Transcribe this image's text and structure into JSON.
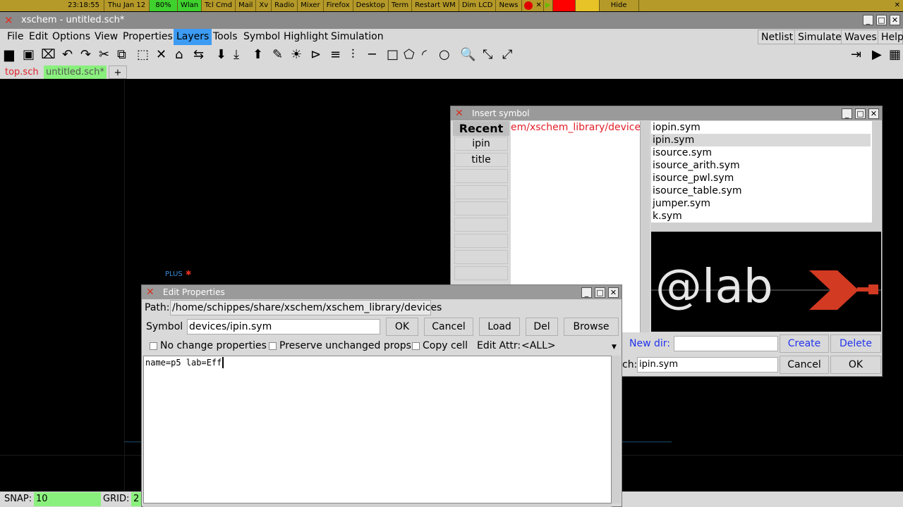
{
  "topbar": {
    "clock": "23:18:55",
    "date": "Thu Jan 12",
    "battery": "80%",
    "items": [
      "Wlan",
      "Tcl Cmd",
      "Mail",
      "Xv",
      "Radio",
      "Mixer",
      "Firefox",
      "Desktop",
      "Term",
      "Restart WM",
      "Dim LCD",
      "News"
    ],
    "hide": "Hide"
  },
  "window": {
    "title": "xschem - untitled.sch*"
  },
  "menu": {
    "items": [
      "File",
      "Edit",
      "Options",
      "View",
      "Properties",
      "Layers",
      "Tools",
      "Symbol",
      "Highlight",
      "Simulation"
    ],
    "active": "Layers",
    "right": [
      "Netlist",
      "Simulate",
      "Waves",
      "Help"
    ]
  },
  "tabs": {
    "items": [
      "top.sch",
      "untitled.sch*"
    ],
    "add": "+"
  },
  "canvas": {
    "pin_label": "PLUS"
  },
  "status": {
    "snap_label": "SNAP:",
    "snap_value": "10",
    "grid_label": "GRID:",
    "grid_value": "2"
  },
  "insert_symbol": {
    "title": "Insert symbol",
    "recent_label": "Recent",
    "recent": [
      "ipin",
      "title",
      "",
      "",
      "",
      "",
      "",
      "",
      ""
    ],
    "path": "em/xschem_library/devices",
    "files": [
      "iopin.sym",
      "ipin.sym",
      "isource.sym",
      "isource_arith.sym",
      "isource_pwl.sym",
      "isource_table.sym",
      "jumper.sym",
      "k.sym"
    ],
    "selected": "ipin.sym",
    "preview_text": "@lab",
    "newdir_label": "New dir:",
    "newdir_value": "",
    "create": "Create",
    "delete": "Delete",
    "search_label": "ch:",
    "search_value": "ipin.sym",
    "cancel": "Cancel",
    "ok": "OK"
  },
  "edit_props": {
    "title": "Edit Properties",
    "path_label": "Path:",
    "path_value": "/home/schippes/share/xschem/xschem_library/devices",
    "symbol_label": "Symbol",
    "symbol_value": "devices/ipin.sym",
    "ok": "OK",
    "cancel": "Cancel",
    "load": "Load",
    "del": "Del",
    "browse": "Browse",
    "no_change": "No change properties",
    "preserve": "Preserve unchanged props",
    "copy_cell": "Copy cell",
    "edit_attr_label": "Edit Attr:",
    "edit_attr_value": "<ALL>",
    "text": "name=p5 lab=Eff"
  },
  "colors": {
    "accent": "#3c9bf3",
    "tab_active": "#8af07d",
    "preview_red": "#d23a22",
    "path_red": "#e0202a"
  }
}
